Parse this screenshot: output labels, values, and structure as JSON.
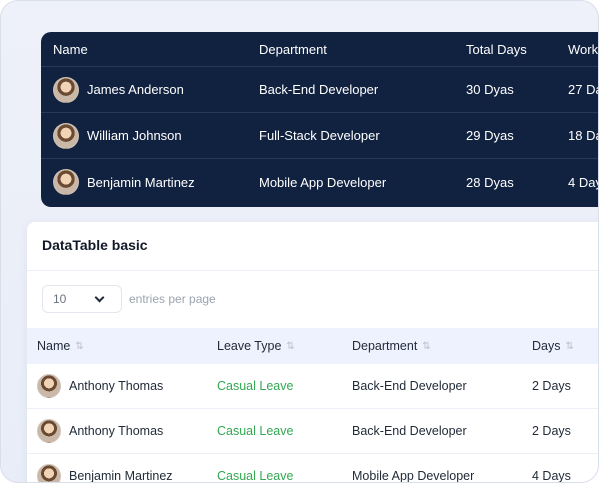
{
  "top_table": {
    "headers": [
      "Name",
      "Department",
      "Total Days",
      "Work"
    ],
    "rows": [
      {
        "name": "James Anderson",
        "department": "Back-End Developer",
        "total_days": "30 Dyas",
        "work": "27 Da"
      },
      {
        "name": "William Johnson",
        "department": "Full-Stack Developer",
        "total_days": "29 Dyas",
        "work": "18 Da"
      },
      {
        "name": "Benjamin Martinez",
        "department": "Mobile App Developer",
        "total_days": "28 Dyas",
        "work": "4 Day"
      }
    ]
  },
  "datatable": {
    "title": "DataTable basic",
    "entries_value": "10",
    "entries_label": "entries per page",
    "headers": [
      "Name",
      "Leave Type",
      "Department",
      "Days"
    ],
    "sort_icon": "⇅",
    "rows": [
      {
        "name": "Anthony Thomas",
        "leave_type": "Casual Leave",
        "department": "Back-End Developer",
        "days": "2 Days"
      },
      {
        "name": "Anthony Thomas",
        "leave_type": "Casual Leave",
        "department": "Back-End Developer",
        "days": "2 Days"
      },
      {
        "name": "Benjamin Martinez",
        "leave_type": "Casual Leave",
        "department": "Mobile App Developer",
        "days": "4 Days"
      }
    ]
  },
  "colors": {
    "dark_table_bg": "#112240",
    "leave_type_text": "#33a852",
    "table_header_bg": "#eef2fe"
  },
  "icons": {
    "select_chevron": "chevron-down-icon",
    "sort": "sort-icon",
    "avatar": "user-avatar"
  }
}
